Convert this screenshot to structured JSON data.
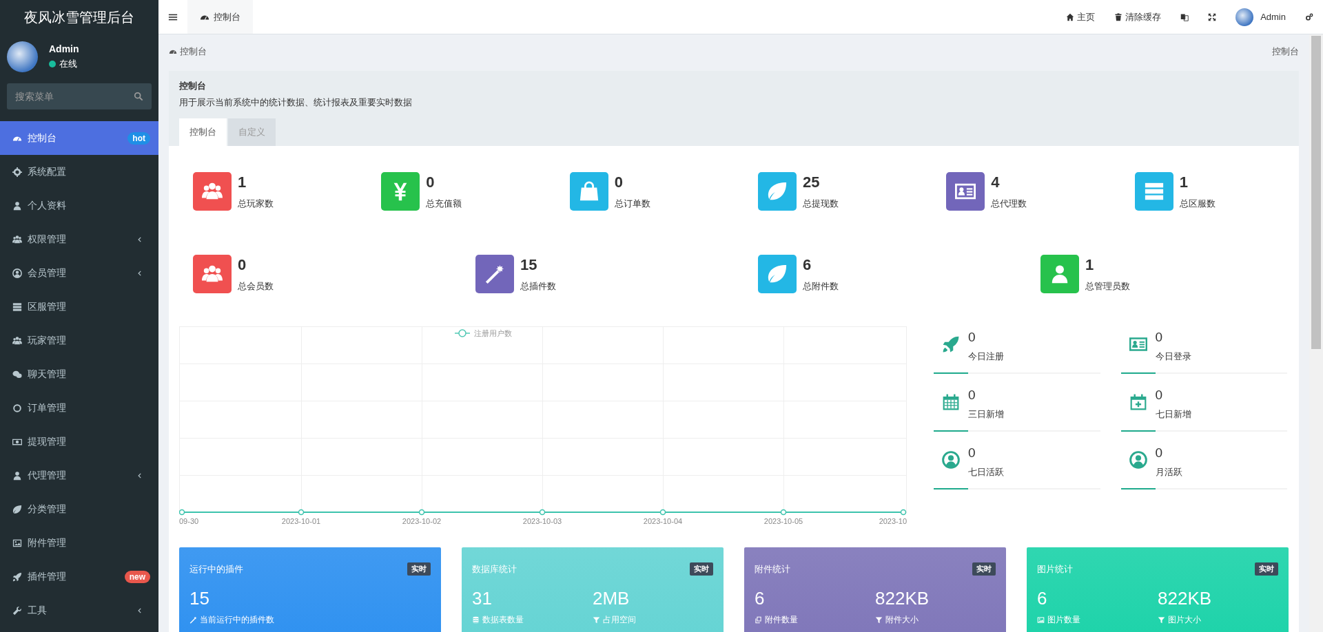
{
  "sidebar": {
    "title": "夜风冰雪管理后台",
    "user": {
      "name": "Admin",
      "status": "在线",
      "online": true
    },
    "search": {
      "placeholder": "搜索菜单"
    },
    "items": [
      {
        "label": "控制台",
        "selected": true,
        "expandable": false,
        "badge": {
          "text": "hot",
          "color": "#1f8fe6"
        }
      },
      {
        "label": "系统配置",
        "selected": false,
        "expandable": false
      },
      {
        "label": "个人资料",
        "selected": false,
        "expandable": false
      },
      {
        "label": "权限管理",
        "selected": false,
        "expandable": true
      },
      {
        "label": "会员管理",
        "selected": false,
        "expandable": true
      },
      {
        "label": "区服管理",
        "selected": false,
        "expandable": false
      },
      {
        "label": "玩家管理",
        "selected": false,
        "expandable": false
      },
      {
        "label": "聊天管理",
        "selected": false,
        "expandable": false
      },
      {
        "label": "订单管理",
        "selected": false,
        "expandable": false
      },
      {
        "label": "提现管理",
        "selected": false,
        "expandable": false
      },
      {
        "label": "代理管理",
        "selected": false,
        "expandable": true
      },
      {
        "label": "分类管理",
        "selected": false,
        "expandable": false
      },
      {
        "label": "附件管理",
        "selected": false,
        "expandable": false
      },
      {
        "label": "插件管理",
        "selected": false,
        "expandable": false,
        "badge": {
          "text": "new",
          "color": "#e8574c"
        }
      },
      {
        "label": "工具",
        "selected": false,
        "expandable": true
      }
    ]
  },
  "topbar": {
    "tab": "控制台",
    "links": [
      {
        "label": "主页"
      },
      {
        "label": "清除缓存"
      }
    ],
    "user": "Admin"
  },
  "breadcrumb": {
    "left": "控制台",
    "right": "控制台"
  },
  "panel": {
    "title": "控制台",
    "description": "用于展示当前系统中的统计数据、统计报表及重要实时数据",
    "tabs": [
      {
        "label": "控制台",
        "selected": true
      },
      {
        "label": "自定义",
        "selected": false
      }
    ]
  },
  "stat_rows": [
    [
      {
        "value": "1",
        "label": "总玩家数",
        "color": "#f05050"
      },
      {
        "value": "0",
        "label": "总充值额",
        "color": "#27c24c"
      },
      {
        "value": "0",
        "label": "总订单数",
        "color": "#23b7e5"
      },
      {
        "value": "25",
        "label": "总提现数",
        "color": "#23b7e5"
      },
      {
        "value": "4",
        "label": "总代理数",
        "color": "#7266ba"
      },
      {
        "value": "1",
        "label": "总区服数",
        "color": "#23b7e5"
      }
    ],
    [
      {
        "value": "0",
        "label": "总会员数",
        "color": "#f05050"
      },
      {
        "value": "15",
        "label": "总插件数",
        "color": "#7266ba"
      },
      {
        "value": "6",
        "label": "总附件数",
        "color": "#23b7e5"
      },
      {
        "value": "1",
        "label": "总管理员数",
        "color": "#27c24c"
      }
    ]
  ],
  "chart": {
    "legend": "注册用户数",
    "x_labels": [
      "09-30",
      "2023-10-01",
      "2023-10-02",
      "2023-10-03",
      "2023-10-04",
      "2023-10-05",
      "2023-10"
    ]
  },
  "quick_stats": [
    {
      "value": "0",
      "label": "今日注册"
    },
    {
      "value": "0",
      "label": "今日登录"
    },
    {
      "value": "0",
      "label": "三日新增"
    },
    {
      "value": "0",
      "label": "七日新增"
    },
    {
      "value": "0",
      "label": "七日活跃"
    },
    {
      "value": "0",
      "label": "月活跃"
    }
  ],
  "cards": [
    {
      "title": "运行中的插件",
      "badge": "实时",
      "color": "#2b8ff0",
      "metrics": [
        {
          "value": "15",
          "label": "当前运行中的插件数"
        }
      ]
    },
    {
      "title": "数据库统计",
      "badge": "实时",
      "color": "#62d3d3",
      "metrics": [
        {
          "value": "31",
          "label": "数据表数量"
        },
        {
          "value": "2MB",
          "label": "占用空间"
        }
      ]
    },
    {
      "title": "附件统计",
      "badge": "实时",
      "color": "#7d74b8",
      "metrics": [
        {
          "value": "6",
          "label": "附件数量"
        },
        {
          "value": "822KB",
          "label": "附件大小"
        }
      ]
    },
    {
      "title": "图片统计",
      "badge": "实时",
      "color": "#19d2a8",
      "metrics": [
        {
          "value": "6",
          "label": "图片数量"
        },
        {
          "value": "822KB",
          "label": "图片大小"
        }
      ]
    }
  ]
}
